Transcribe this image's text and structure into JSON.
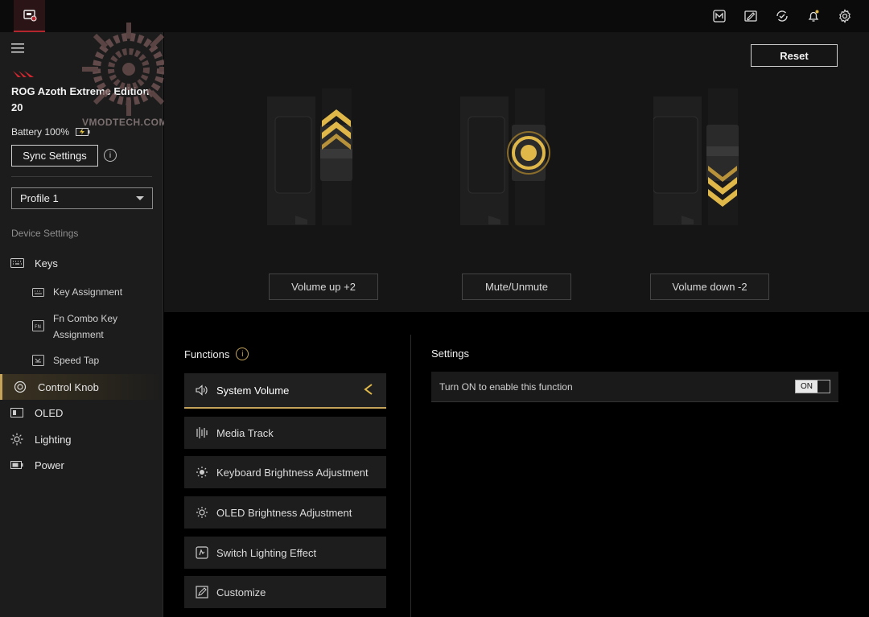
{
  "topbar": {
    "icons": [
      "armoury-crate-icon",
      "m-icon",
      "edit-icon",
      "sync-icon",
      "bell-icon",
      "gear-icon"
    ],
    "accent": "#b3262e"
  },
  "sidebar": {
    "device_name": "ROG Azoth Extreme Edition 20",
    "battery": "Battery 100%",
    "sync_label": "Sync Settings",
    "profile": "Profile 1",
    "section_label": "Device Settings",
    "items": [
      {
        "label": "Keys"
      },
      {
        "label": "Key Assignment"
      },
      {
        "label": "Fn Combo Key Assignment"
      },
      {
        "label": "Speed Tap"
      },
      {
        "label": "Control Knob"
      },
      {
        "label": "OLED"
      },
      {
        "label": "Lighting"
      },
      {
        "label": "Power"
      }
    ]
  },
  "watermark": "VMODTECH.COM",
  "knob": {
    "reset_label": "Reset",
    "actions": [
      {
        "label": "Volume up +2"
      },
      {
        "label": "Mute/Unmute"
      },
      {
        "label": "Volume down -2"
      }
    ],
    "accent": "#e0b84a"
  },
  "functions": {
    "title": "Functions",
    "items": [
      {
        "label": "System Volume",
        "icon": "volume-icon",
        "active": true
      },
      {
        "label": "Media Track",
        "icon": "media-track-icon"
      },
      {
        "label": "Keyboard Brightness Adjustment",
        "icon": "sun-icon"
      },
      {
        "label": "OLED Brightness Adjustment",
        "icon": "sun-outline-icon"
      },
      {
        "label": "Switch Lighting Effect",
        "icon": "lighting-effect-icon"
      },
      {
        "label": "Customize",
        "icon": "customize-icon"
      }
    ]
  },
  "settings": {
    "title": "Settings",
    "enable_text": "Turn ON to enable this function",
    "toggle_label": "ON"
  }
}
